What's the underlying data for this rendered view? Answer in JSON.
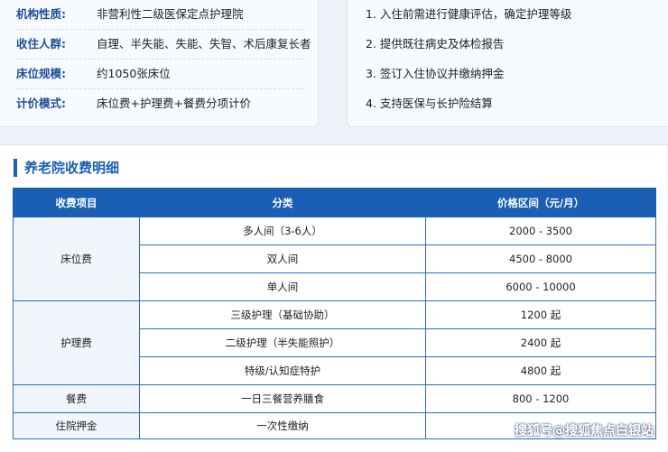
{
  "institution_info": [
    {
      "label": "机构性质:",
      "value": "非营利性二级医保定点护理院"
    },
    {
      "label": "收住人群:",
      "value": "自理、半失能、失能、失智、术后康复长者"
    },
    {
      "label": "床位规模:",
      "value": "约1050张床位"
    },
    {
      "label": "计价模式:",
      "value": "床位费+护理费+餐费分项计价"
    }
  ],
  "admission_steps": [
    "1. 入住前需进行健康评估，确定护理等级",
    "2. 提供既往病史及体检报告",
    "3. 签订入住协议并缴纳押金",
    "4. 支持医保与长护险结算"
  ],
  "fee_section": {
    "title": "养老院收费明细",
    "headers": {
      "item": "收费项目",
      "category": "分类",
      "price": "价格区间（元/月）"
    },
    "groups": [
      {
        "item": "床位费",
        "rows": [
          {
            "category": "多人间（3-6人）",
            "price": "2000 - 3500"
          },
          {
            "category": "双人间",
            "price": "4500 - 8000"
          },
          {
            "category": "单人间",
            "price": "6000 - 10000"
          }
        ]
      },
      {
        "item": "护理费",
        "rows": [
          {
            "category": "三级护理（基础协助）",
            "price": "1200 起"
          },
          {
            "category": "二级护理（半失能照护）",
            "price": "2400 起"
          },
          {
            "category": "特级/认知症特护",
            "price": "4800 起"
          }
        ]
      },
      {
        "item": "餐费",
        "rows": [
          {
            "category": "一日三餐营养膳食",
            "price": "800 - 1200"
          }
        ]
      },
      {
        "item": "住院押金",
        "rows": [
          {
            "category": "一次性缴纳",
            "price": ""
          }
        ]
      }
    ]
  },
  "watermark": "搜狐号@搜狐焦点白银站",
  "colors": {
    "accent": "#1a5fb4",
    "label": "#1d4f9c",
    "background": "#eef3f9"
  }
}
